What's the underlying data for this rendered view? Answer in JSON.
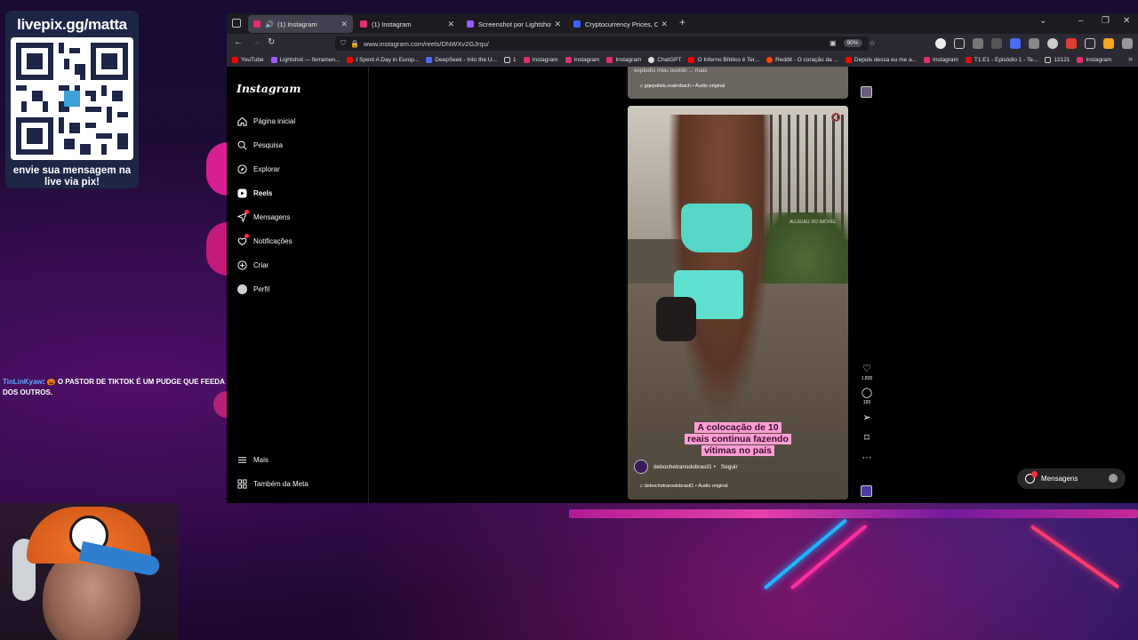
{
  "overlay": {
    "livepix_title": "livepix.gg/matta",
    "livepix_caption": "envie sua mensagem na live via pix!",
    "chat": {
      "user": "TinLinKyaw",
      "message": ": 🎃 O PASTOR DE TIKTOK É UM PUDGE QUE FEEDA A ALMA DOS OUTROS."
    }
  },
  "browser": {
    "tabs": [
      {
        "label": "(1) Instagram",
        "active": true,
        "favicon": "instagram-icon",
        "color": "#e1306c"
      },
      {
        "label": "(1) Instagram",
        "active": false,
        "favicon": "instagram-icon",
        "color": "#e1306c"
      },
      {
        "label": "Screenshot por Lightshot",
        "active": false,
        "favicon": "lightshot-icon",
        "color": "#9b59ff"
      },
      {
        "label": "Cryptocurrency Prices, Charts A",
        "active": false,
        "favicon": "coinmarketcap-icon",
        "color": "#3861fb"
      }
    ],
    "url": "www.instagram.com/reels/DNWXv2GJrqu/",
    "zoom": "90%",
    "bookmarks": [
      {
        "label": "YouTube",
        "color": "#ff0000"
      },
      {
        "label": "Lightshot — ferramen...",
        "color": "#9b59ff"
      },
      {
        "label": "I Spent A Day in Europ...",
        "color": "#ff0000"
      },
      {
        "label": "DeepSeek - Into the U...",
        "color": "#4d6bfe"
      },
      {
        "label": "1",
        "color": "#cccccc"
      },
      {
        "label": "Instagram",
        "color": "#e1306c"
      },
      {
        "label": "Instagram",
        "color": "#e1306c"
      },
      {
        "label": "Instagram",
        "color": "#e1306c"
      },
      {
        "label": "ChatGPT",
        "color": "#dddddd"
      },
      {
        "label": "O Inferno Bíblico é Ter...",
        "color": "#ff0000"
      },
      {
        "label": "Reddit - O coração da ...",
        "color": "#ff4500"
      },
      {
        "label": "Depois dessa eu me a...",
        "color": "#ff0000"
      },
      {
        "label": "Instagram",
        "color": "#e1306c"
      },
      {
        "label": "T1:E1 - Episódio 1 - Te...",
        "color": "#e50914"
      },
      {
        "label": "12121",
        "color": "#cccccc"
      },
      {
        "label": "Instagram",
        "color": "#e1306c"
      }
    ]
  },
  "instagram": {
    "logo": "Instagram",
    "nav": [
      {
        "label": "Página inicial",
        "icon": "home-icon"
      },
      {
        "label": "Pesquisa",
        "icon": "search-icon"
      },
      {
        "label": "Explorar",
        "icon": "compass-icon"
      },
      {
        "label": "Reels",
        "icon": "reels-icon",
        "active": true
      },
      {
        "label": "Mensagens",
        "icon": "messenger-icon",
        "badge": true
      },
      {
        "label": "Notificações",
        "icon": "heart-icon",
        "badge": true
      },
      {
        "label": "Criar",
        "icon": "plus-icon"
      },
      {
        "label": "Perfil",
        "icon": "avatar-icon"
      }
    ],
    "bottom_nav": [
      {
        "label": "Mais",
        "icon": "menu-icon"
      },
      {
        "label": "Também da Meta",
        "icon": "meta-icon"
      }
    ],
    "prev_reel": {
      "caption": "explodiu meu ouvido ...",
      "more": " mais",
      "audio": "♫ gqepafala.xvairobach • Áudio original"
    },
    "reel": {
      "overlay_line1": "A colocação de 10",
      "overlay_line2": "reais continua fazendo",
      "overlay_line3": "vítimas no país",
      "sign_text": "ALUGUEL DO IMÓVEL",
      "author": "debochetransdobrasil1",
      "follow": "Seguir",
      "audio": "♫ debochetransdobrasil1 • Áudio original",
      "likes": "1.835",
      "comments": "193"
    },
    "messages_pill": "Mensagens"
  }
}
